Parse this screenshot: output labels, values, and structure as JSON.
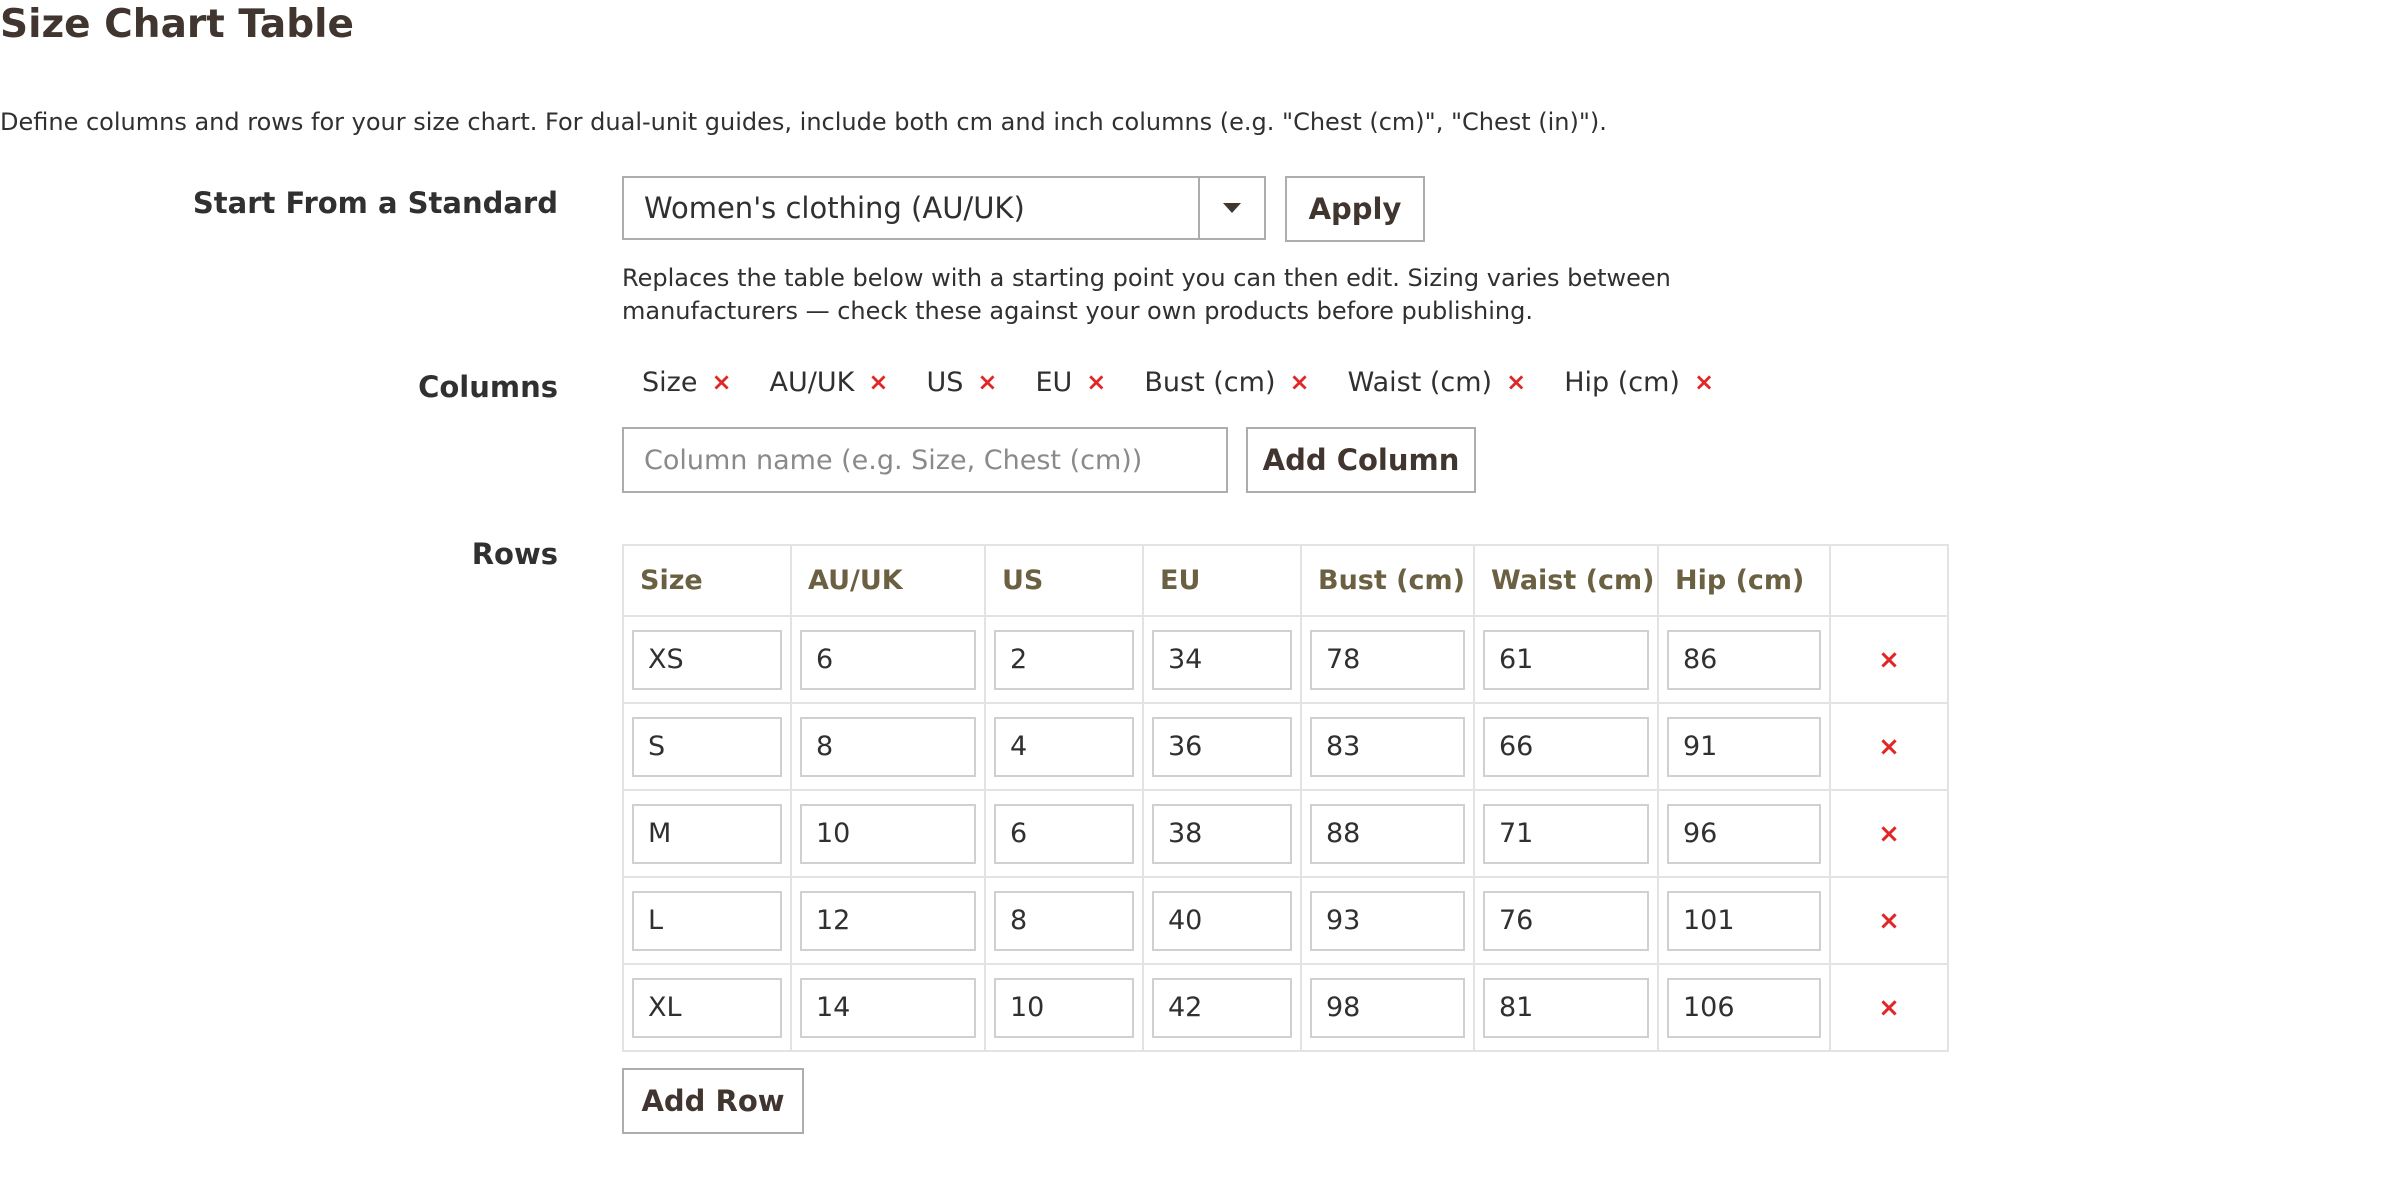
{
  "title": "Size Chart Table",
  "intro": "Define columns and rows for your size chart. For dual-unit guides, include both cm and inch columns (e.g. \"Chest (cm)\", \"Chest (in)\").",
  "standard": {
    "label": "Start From a Standard",
    "selected": "Women's clothing (AU/UK)",
    "apply_label": "Apply",
    "note": "Replaces the table below with a starting point you can then edit. Sizing varies between manufacturers — check these against your own products before publishing."
  },
  "columns": {
    "label": "Columns",
    "items": [
      "Size",
      "AU/UK",
      "US",
      "EU",
      "Bust (cm)",
      "Waist (cm)",
      "Hip (cm)"
    ],
    "remove_glyph": "×",
    "input_placeholder": "Column name (e.g. Size, Chest (cm))",
    "add_label": "Add Column"
  },
  "rows": {
    "label": "Rows",
    "headers": [
      "Size",
      "AU/UK",
      "US",
      "EU",
      "Bust (cm)",
      "Waist (cm)",
      "Hip (cm)"
    ],
    "data": [
      [
        "XS",
        "6",
        "2",
        "34",
        "78",
        "61",
        "86"
      ],
      [
        "S",
        "8",
        "4",
        "36",
        "83",
        "66",
        "91"
      ],
      [
        "M",
        "10",
        "6",
        "38",
        "88",
        "71",
        "96"
      ],
      [
        "L",
        "12",
        "8",
        "40",
        "93",
        "76",
        "101"
      ],
      [
        "XL",
        "14",
        "10",
        "42",
        "98",
        "81",
        "106"
      ]
    ],
    "remove_glyph": "×",
    "add_label": "Add Row"
  },
  "colors": {
    "title": "#41362f",
    "remove": "#e22626",
    "header_text": "#6b6042",
    "border": "#adadad"
  }
}
